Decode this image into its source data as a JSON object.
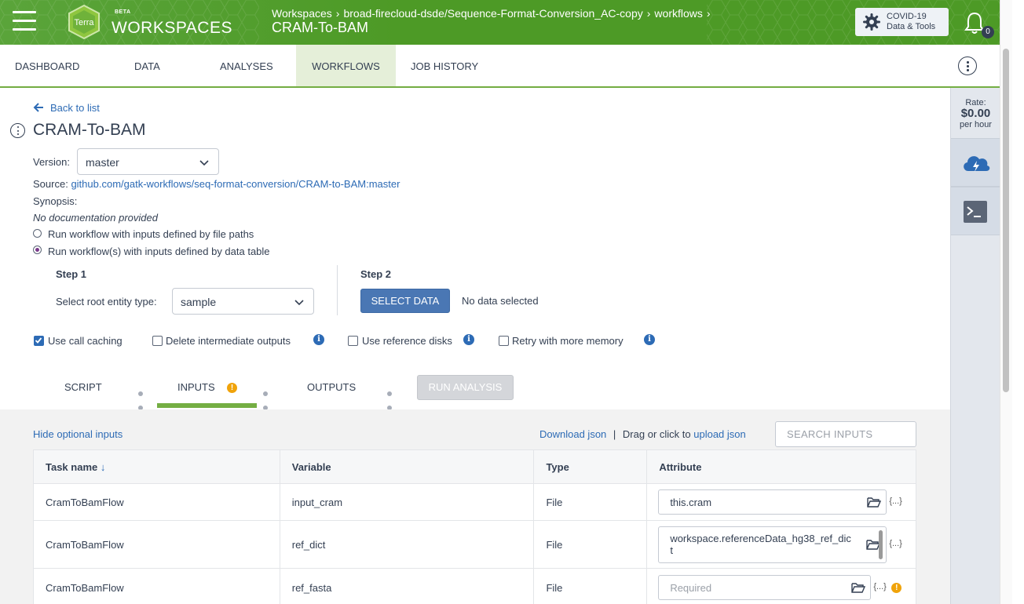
{
  "header": {
    "logo_text": "Terra",
    "beta": "BETA",
    "brand": "WORKSPACES",
    "breadcrumb": [
      "Workspaces",
      "broad-firecloud-dsde/Sequence-Format-Conversion_AC-copy",
      "workflows"
    ],
    "breadcrumb_sep": "›",
    "title": "CRAM-To-BAM",
    "covid_line1": "COVID-19",
    "covid_line2": "Data & Tools",
    "notification_count": "0"
  },
  "tabs": [
    {
      "label": "DASHBOARD"
    },
    {
      "label": "DATA"
    },
    {
      "label": "ANALYSES"
    },
    {
      "label": "WORKFLOWS",
      "active": true
    },
    {
      "label": "JOB HISTORY"
    }
  ],
  "side_panel": {
    "rate_label": "Rate:",
    "rate_value": "$0.00",
    "rate_unit": "per hour",
    "icons": [
      "cloud-lightning-icon",
      "terminal-icon"
    ]
  },
  "workflow": {
    "back_label": "Back to list",
    "name": "CRAM-To-BAM",
    "version_label": "Version:",
    "version_value": "master",
    "source_label": "Source:",
    "source_link": "github.com/gatk-workflows/seq-format-conversion/CRAM-to-BAM:master",
    "synopsis_label": "Synopsis:",
    "documentation": "No documentation provided",
    "radio_file_paths": "Run workflow with inputs defined by file paths",
    "radio_data_table": "Run workflow(s) with inputs defined by data table",
    "radio_selected": "data_table",
    "step1_title": "Step 1",
    "root_entity_label": "Select root entity type:",
    "root_entity_value": "sample",
    "step2_title": "Step 2",
    "select_data_button": "SELECT DATA",
    "no_data_text": "No data selected",
    "options": [
      {
        "label": "Use call caching",
        "checked": true,
        "info": false
      },
      {
        "label": "Delete intermediate outputs",
        "checked": false,
        "info": true
      },
      {
        "label": "Use reference disks",
        "checked": false,
        "info": true
      },
      {
        "label": "Retry with more memory",
        "checked": false,
        "info": true
      }
    ],
    "subtabs": {
      "script": "SCRIPT",
      "inputs": "INPUTS",
      "outputs": "OUTPUTS",
      "run": "RUN ANALYSIS"
    }
  },
  "inputs_section": {
    "hide_optional": "Hide optional inputs",
    "download_json": "Download json",
    "separator": "|",
    "drag_text": "Drag or click to",
    "upload_json": "upload json",
    "search_placeholder": "SEARCH INPUTS",
    "columns": [
      "Task name",
      "Variable",
      "Type",
      "Attribute"
    ],
    "sort_indicator": "↓",
    "json_icon_text": "{...}",
    "rows": [
      {
        "task": "CramToBamFlow",
        "variable": "input_cram",
        "type": "File",
        "attribute": "this.cram",
        "placeholder": "",
        "warning": false
      },
      {
        "task": "CramToBamFlow",
        "variable": "ref_dict",
        "type": "File",
        "attribute": "workspace.referenceData_hg38_ref_dict",
        "placeholder": "",
        "warning": false
      },
      {
        "task": "CramToBamFlow",
        "variable": "ref_fasta",
        "type": "File",
        "attribute": "",
        "placeholder": "Required",
        "warning": true
      }
    ]
  },
  "colors": {
    "header_green": "#4d9a26",
    "active_tab_bg": "#e5efd9",
    "link_blue": "#2d6bb5",
    "primary_button": "#4a77b4",
    "warning": "#f0a30a"
  }
}
